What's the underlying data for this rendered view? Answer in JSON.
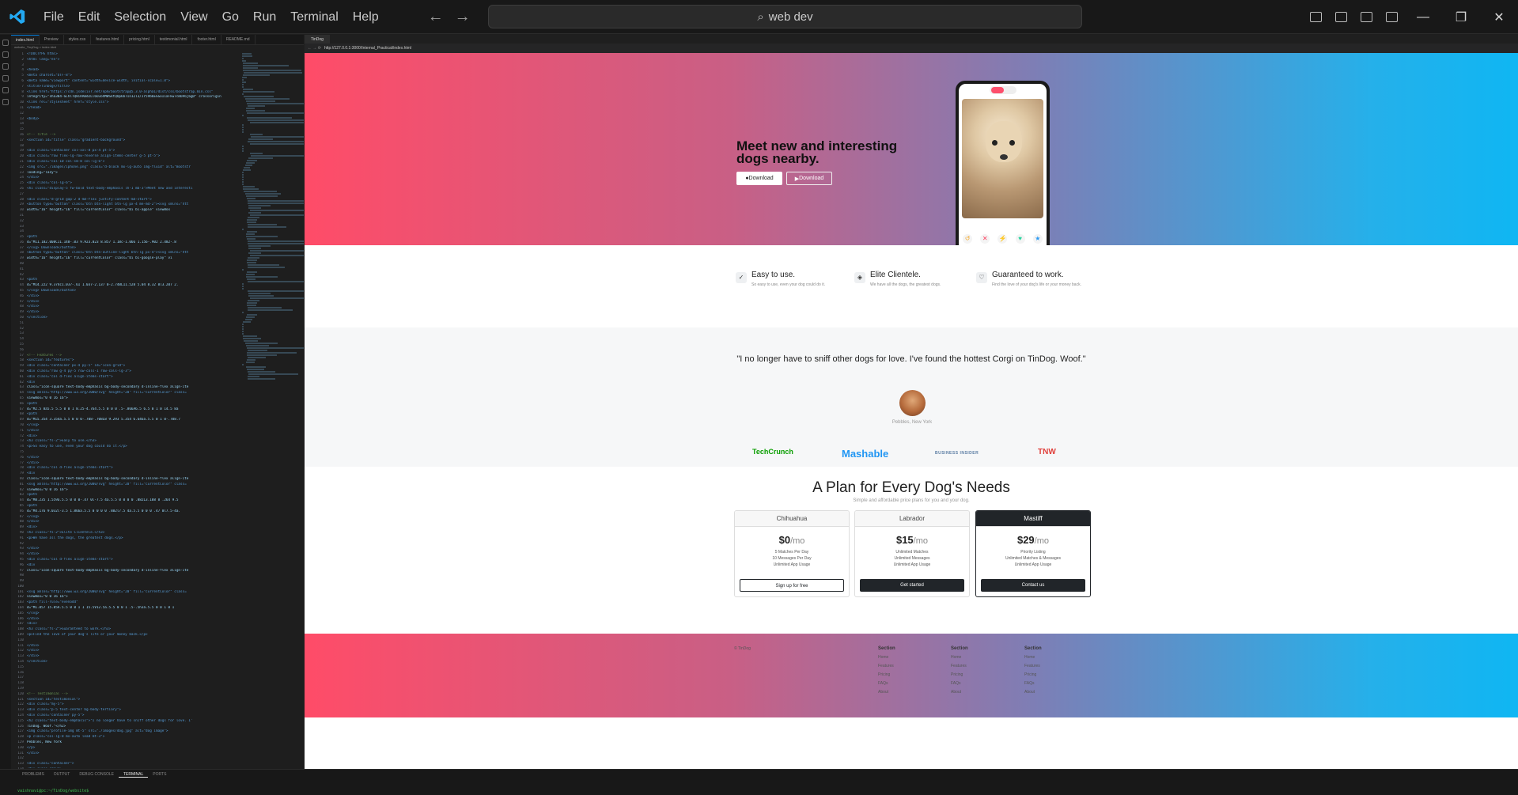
{
  "titlebar": {
    "menu": [
      "File",
      "Edit",
      "Selection",
      "View",
      "Go",
      "Run",
      "Terminal",
      "Help"
    ],
    "search_text": "web dev"
  },
  "editor": {
    "tabs": [
      "index.html",
      "Preview",
      "styles.css",
      "features.html",
      "pricing.html",
      "testimonial.html",
      "footer.html",
      "README.md"
    ],
    "breadcrumb": "website_TinyDog > index.html",
    "code_lines": [
      "<!DOCTYPE html>",
      "<html lang=\"en\">",
      "",
      "<head>",
      "  <meta charset=\"UTF-8\">",
      "  <meta name=\"viewport\" content=\"width=device-width, initial-scale=1.0\">",
      "  <title>TinDog</title>",
      "  <link href=\"https://cdn.jsdelivr.net/npm/bootstrap@5.3.0-alpha1/dist/css/bootstrap.min.css\"",
      "    integrity=\"sha384-GLhlTQ8iRABdZLl6O3oVMWSktQOp6b7In1Zl3/Jr59b6EGGoI1aFkw7cmDA6j6gD\" crossorigin",
      "  <link rel=\"stylesheet\" href=\"style.css\">",
      "</head>",
      "",
      "<body>",
      "",
      "",
      "  <!-- Title -->",
      "  <section id=\"title\" class=\"gradient-background\">",
      "",
      "    <div class=\"container col-xxl-8 px-4 pt-5\">",
      "      <div class=\"row flex-lg-row-reverse align-items-center g-5 pt-5\">",
      "        <div class=\"col-10 col-sm-8 col-lg-6\">",
      "          <img src=\"./images/iphone.png\" class=\"d-block mx-lg-auto img-fluid\" alt=\"Bootstr",
      "            loading=\"lazy\">",
      "        </div>",
      "        <div class=\"col-lg-6\">",
      "          <h1 class=\"display-5 fw-bold text-body-emphasis lh-1 mb-3\">Meet new and interesti",
      "",
      "          <div class=\"d-grid gap-2 d-md-flex justify-content-md-start\">",
      "            <button type=\"button\" class=\"btn btn-light btn-lg px-4 me-md-2\"><svg xmlns=\"htt",
      "                width=\"16\" height=\"16\" fill=\"currentColor\" class=\"bi bi-apple\" viewBox",
      "",
      "",
      "",
      "",
      "                <path",
      "                  d=\"M11.182.008C11.148-.03 9.923.023 8.857 1.18c-1.066 1.156-.902 2.482-.8",
      "              </svg> Download</button>",
      "            <button type=\"button\" class=\"btn btn-outline-light btn-lg px-4\"><svg xmlns=\"htt",
      "                width=\"16\" height=\"16\" fill=\"currentColor\" class=\"bi bi-google-play\" vi",
      "",
      "",
      "",
      "                <path",
      "                  d=\"M14.222 9.374c1.037-.61 1.037-2.137 0-2.748L11.528 5.04 8.32 8l3.207 2.",
      "              </svg> Download</button>",
      "          </div>",
      "        </div>",
      "      </div>",
      "    </div>",
      "  </section>",
      "",
      "",
      "",
      "",
      "",
      "",
      "  <!-- Features -->",
      "  <section id=\"features\">",
      "    <div class=\"container px-4 py-5\" id=\"icon-grid\">",
      "      <div class=\"row g-4 py-5 row-cols-1 row-cols-lg-3\">",
      "        <div class=\"col d-flex align-items-start\">",
      "          <div",
      "            class=\"icon-square text-body-emphasis bg-body-secondary d-inline-flex align-ite",
      "            <svg xmlns=\"http://www.w3.org/2000/svg\" height=\"20\" fill=\"currentColor\" class=",
      "              viewBox=\"0 0 16 16\">",
      "              <path",
      "                d=\"M2.5 8a5.5 5.5 0 0 1 8.25-4.764.5.5 0 0 0 .5-.866A6.5 6.5 0 1 0 14.5 8a",
      "              <path",
      "                d=\"M15.354 3.354a.5.5 0 0 0-.708-.708L8 9.293 5.354 6.646a.5.5 0 1 0-.708.7",
      "            </svg>",
      "          </div>",
      "          <div>",
      "            <h3 class=\"fs-2\">Easy to use.</h3>",
      "            <p>So easy to use, even your dog could do it.</p>",
      "",
      "          </div>",
      "        </div>",
      "        <div class=\"col d-flex align-items-start\">",
      "          <div",
      "            class=\"icon-square text-body-emphasis bg-body-secondary d-inline-flex align-ite",
      "            <svg xmlns=\"http://www.w3.org/2000/svg\" height=\"20\" fill=\"currentColor\" class=",
      "              viewBox=\"0 0 16 16\">",
      "              <path",
      "                d=\"M8.235 1.559a.5.5 0 0 0-.47 0l-7.5 4a.5.5 0 0 0 0 .882L3.188 8 .264 9.5",
      "              <path",
      "                d=\"M4.176 9.032l-3.5 1.866a.5.5 0 0 0 0 .882l7.5 4a.5.5 0 0 0 .47 0l7.5-4a.",
      "            </svg>",
      "          </div>",
      "          <div>",
      "            <h3 class=\"fs-2\">Elite Clientele.</h3>",
      "            <p>We have all the dogs, the greatest dogs.</p>",
      "",
      "          </div>",
      "        </div>",
      "        <div class=\"col d-flex align-items-start\">",
      "          <div",
      "            class=\"icon-square text-body-emphasis bg-body-secondary d-inline-flex align-ite",
      "",
      "",
      "",
      "            <svg xmlns=\"http://www.w3.org/2000/svg\" height=\"20\" fill=\"currentColor\" class=",
      "              viewBox=\"0 0 16 16\">",
      "              <path fill-rule=\"evenodd\"",
      "                d=\"M1.857 15.85A.5.5 0 0 1 1 15.5V12.5a.5.5 0 0 1 .5-.5h3a.5.5 0 0 1 0 1",
      "            </svg>",
      "          </div>",
      "          <div>",
      "            <h3 class=\"fs-2\">Guaranteed to work.</h3>",
      "            <p>Find the love of your dog's life or your money back.</p>",
      "",
      "          </div>",
      "        </div>",
      "      </div>",
      "  </section>",
      "",
      "",
      "",
      "",
      "",
      "  <!-- Testimonial -->",
      "  <section id=\"testimonial\">",
      "    <div class=\"my-5\">",
      "      <div class=\"p-5 text-center bg-body-tertiary\">",
      "        <div class=\"container py-5\">",
      "          <h2 class=\"text-body-emphasis\">\"I no longer have to sniff other dogs for love. I'",
      "            TinDog. Woof.\"</h2>",
      "          <img class=\"profile-img mt-5\" src=\"./images/dog.jpg\" alt=\"dog image\">",
      "          <p class=\"col-lg-8 mx-auto lead mt-3\">",
      "            Pebbles, New York",
      "          </p>",
      "        </div>",
      "",
      "        <div class=\"container\">",
      "          <div class=\"row\">",
      "            <div class=\"col-lg-3 col-md-12\">",
      "              <img src=\"./images/techcrunch.png\" alt=\"techcrunch\" height=\"30\">",
      "            </div>",
      "            <div class=\"col-lg-3 col-md-12\">"
    ]
  },
  "browser": {
    "tab_title": "TinDog",
    "url": "http://127.0.0.1:3000/Internal_Practical/index.html",
    "hero": {
      "title": "Meet new and interesting dogs nearby.",
      "btn1": "Download",
      "btn2": "Download"
    },
    "features": [
      {
        "icon": "check-circle-icon",
        "title": "Easy to use.",
        "desc": "So easy to use, even your dog could do it."
      },
      {
        "icon": "layers-icon",
        "title": "Elite Clientele.",
        "desc": "We have all the dogs, the greatest dogs."
      },
      {
        "icon": "heart-check-icon",
        "title": "Guaranteed to work.",
        "desc": "Find the love of your dog's life or your money back."
      }
    ],
    "testimonial": {
      "quote": "\"I no longer have to sniff other dogs for love. I've found the hottest Corgi on TinDog. Woof.\"",
      "author": "Pebbles, New York",
      "logos": [
        "TechCrunch",
        "Mashable",
        "BUSINESS INSIDER",
        "TNW"
      ]
    },
    "pricing": {
      "title": "A Plan for Every Dog's Needs",
      "subtitle": "Simple and affordable price plans for you and your dog.",
      "plans": [
        {
          "name": "Chihuahua",
          "price": "$0",
          "per": "/mo",
          "features": [
            "5 Matches Per Day",
            "10 Messages Per Day",
            "Unlimited App Usage"
          ],
          "button": "Sign up for free"
        },
        {
          "name": "Labrador",
          "price": "$15",
          "per": "/mo",
          "features": [
            "Unlimited Matches",
            "Unlimited Messages",
            "Unlimited App Usage"
          ],
          "button": "Get started"
        },
        {
          "name": "Mastiff",
          "price": "$29",
          "per": "/mo",
          "features": [
            "Priority Listing",
            "Unlimited Matches & Messages",
            "Unlimited App Usage"
          ],
          "button": "Contact us"
        }
      ]
    },
    "footer": {
      "copyright": "© TinDog",
      "columns": [
        {
          "heading": "Section",
          "links": [
            "Home",
            "Features",
            "Pricing",
            "FAQs",
            "About"
          ]
        },
        {
          "heading": "Section",
          "links": [
            "Home",
            "Features",
            "Pricing",
            "FAQs",
            "About"
          ]
        },
        {
          "heading": "Section",
          "links": [
            "Home",
            "Features",
            "Pricing",
            "FAQs",
            "About"
          ]
        }
      ]
    }
  },
  "panel": {
    "tabs": [
      "PROBLEMS",
      "OUTPUT",
      "DEBUG CONSOLE",
      "TERMINAL",
      "PORTS"
    ],
    "terminal_line": "vaishnavi@pc:~/TinDog/website$"
  },
  "colors": {
    "accent": "#0078d4",
    "hero_start": "#ff4c68",
    "hero_end": "#0fb6f3",
    "dark_button": "#212529"
  }
}
